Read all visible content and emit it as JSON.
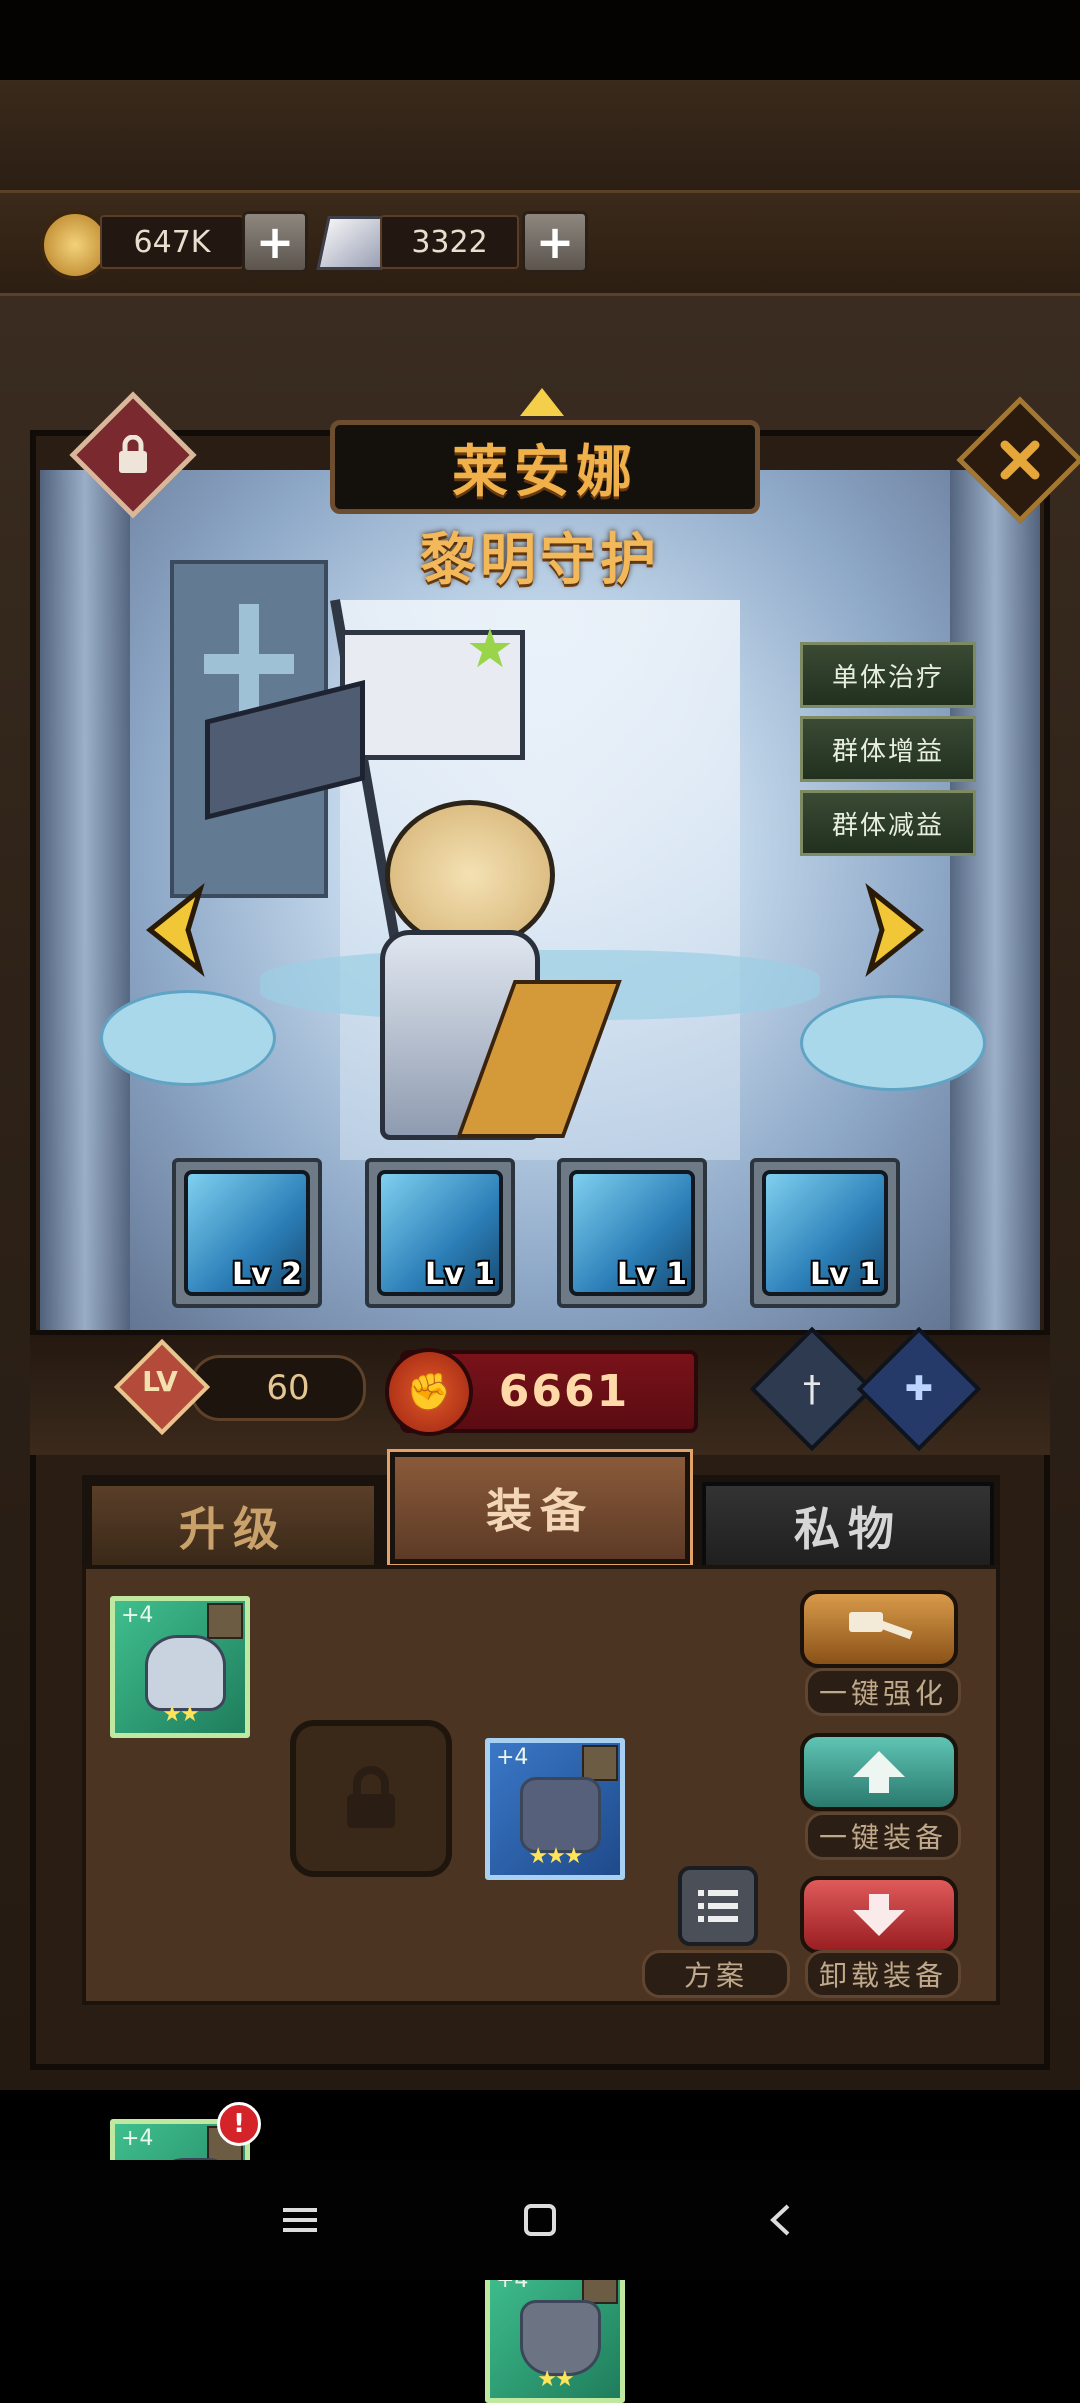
{
  "resources": {
    "gold": {
      "icon": "gold-coin-icon",
      "value": "647K",
      "plus": "+"
    },
    "crystal": {
      "icon": "crystal-book-icon",
      "value": "3322",
      "plus": "+"
    }
  },
  "hero": {
    "name": "莱安娜",
    "title": "黎明守护",
    "tags": [
      "单体治疗",
      "群体增益",
      "群体减益"
    ],
    "skills": [
      {
        "icon": "healing-banner-skill-icon",
        "level": "Lv 2"
      },
      {
        "icon": "spinning-banner-skill-icon",
        "level": "Lv 1"
      },
      {
        "icon": "banner-strike-skill-icon",
        "level": "Lv 1"
      },
      {
        "icon": "shield-banner-skill-icon",
        "level": "Lv 1"
      }
    ],
    "level_label": "LV",
    "level": "60",
    "power": "6661"
  },
  "tabs": [
    {
      "label": "升级",
      "state": "inactive"
    },
    {
      "label": "装备",
      "state": "active"
    },
    {
      "label": "私物",
      "state": "inactive"
    }
  ],
  "equipment": {
    "slots": [
      {
        "name": "helmet",
        "enhance": "+4",
        "stars": "★★",
        "alert": ""
      },
      {
        "name": "armor",
        "enhance": "+4",
        "stars": "★★★",
        "alert": ""
      },
      {
        "name": "gauntlet",
        "enhance": "+4",
        "stars": "★★",
        "alert": "!"
      },
      {
        "name": "boots",
        "enhance": "+4",
        "stars": "★★",
        "alert": ""
      }
    ],
    "actions": {
      "enhance_all": "一键强化",
      "equip_all": "一键装备",
      "unequip_all": "卸载装备",
      "preset": "方案"
    }
  },
  "colors": {
    "accent_gold": "#f0b04a",
    "power_red": "#7a121a",
    "tab_active": "#6a3f2a"
  }
}
